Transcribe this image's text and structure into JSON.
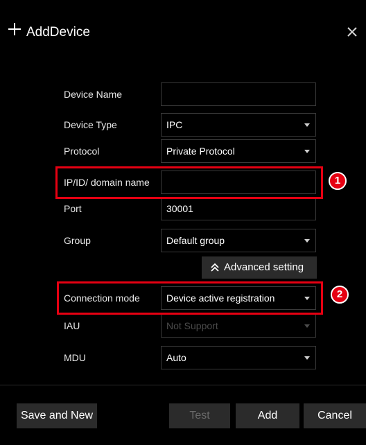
{
  "dialog": {
    "title": "AddDevice",
    "close_glyph": "×"
  },
  "form": {
    "device_name": {
      "label": "Device Name",
      "value": ""
    },
    "device_type": {
      "label": "Device Type",
      "value": "IPC"
    },
    "protocol": {
      "label": "Protocol",
      "value": "Private Protocol"
    },
    "ip_domain": {
      "label": "IP/ID/ domain name",
      "value": ""
    },
    "port": {
      "label": "Port",
      "value": "30001"
    },
    "group": {
      "label": "Group",
      "value": "Default group"
    },
    "advanced_setting": {
      "label": "Advanced setting"
    },
    "connection_mode": {
      "label": "Connection mode",
      "value": "Device active registration"
    },
    "iau": {
      "label": "IAU",
      "value": "Not Support"
    },
    "mdu": {
      "label": "MDU",
      "value": "Auto"
    }
  },
  "annotations": {
    "badge_1": "1",
    "badge_2": "2",
    "highlight_color": "#e60012"
  },
  "footer": {
    "save_and_new": "Save and New",
    "test": "Test",
    "add": "Add",
    "cancel": "Cancel"
  },
  "colors": {
    "background": "#000000",
    "field_border": "#3a3a3a",
    "button_bg": "#2b2b2b",
    "disabled_text": "#4a4a4a"
  }
}
